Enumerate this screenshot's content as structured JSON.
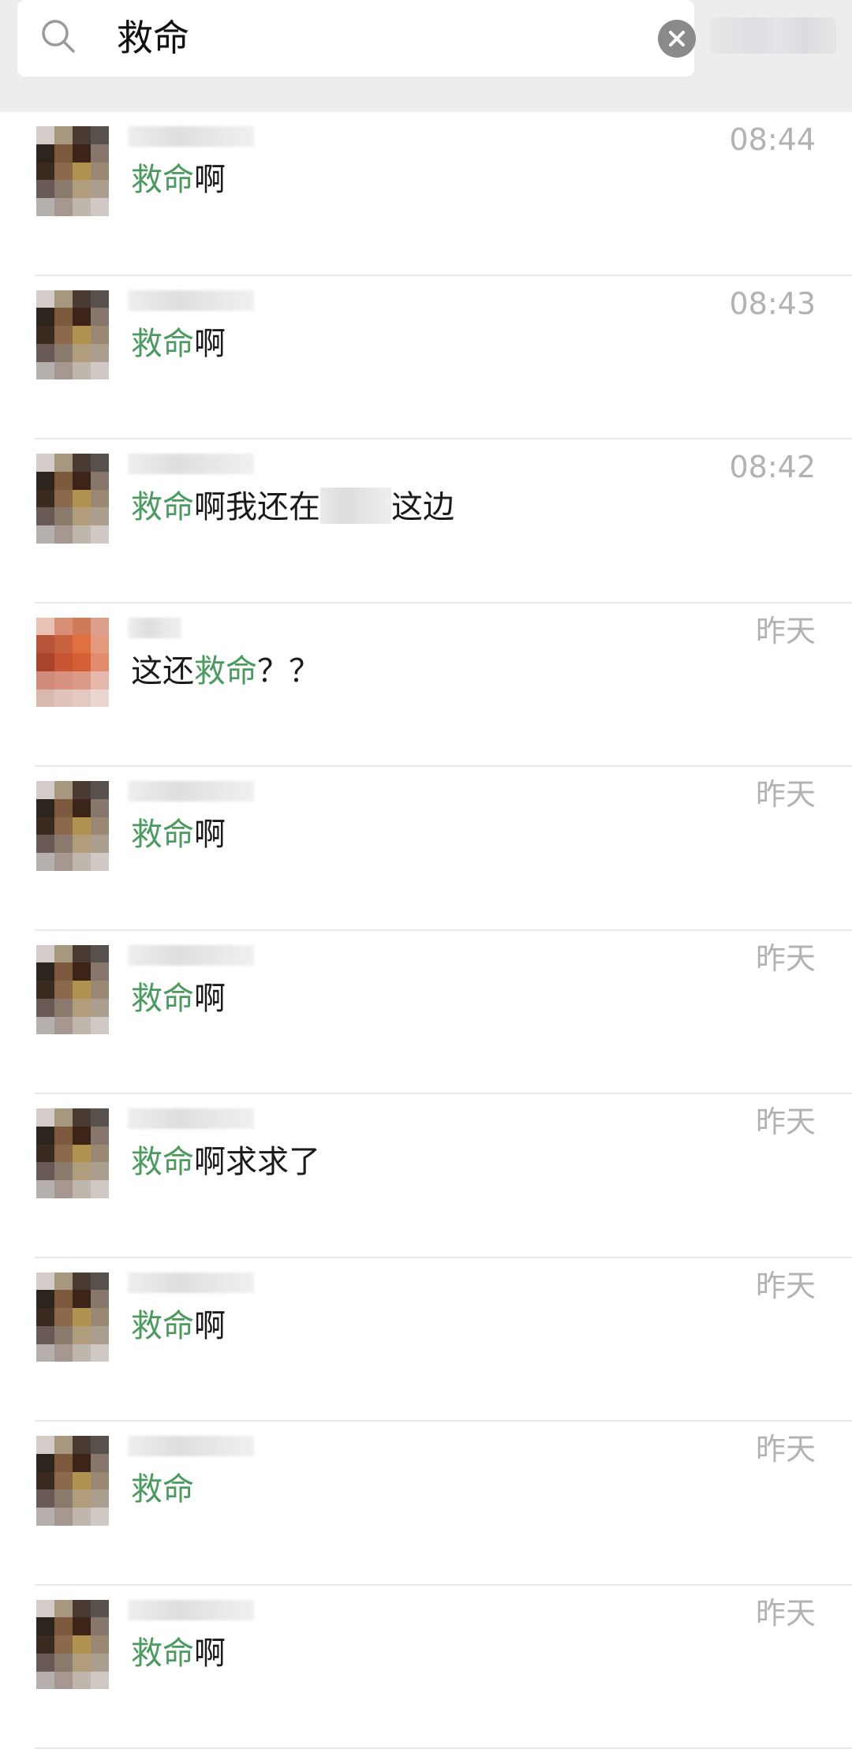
{
  "search": {
    "query": "救命"
  },
  "results": [
    {
      "time": "08:44",
      "name_short": false,
      "avatar": "dark",
      "pre": "",
      "hl": "救命",
      "post": "啊"
    },
    {
      "time": "08:43",
      "name_short": false,
      "avatar": "dark",
      "pre": "",
      "hl": "救命",
      "post": "啊"
    },
    {
      "time": "08:42",
      "name_short": false,
      "avatar": "dark",
      "pre": "",
      "hl": "救命",
      "post": "啊我还在",
      "redacted": true,
      "tail": "这边"
    },
    {
      "time": "昨天",
      "name_short": true,
      "avatar": "orange",
      "pre": "这还",
      "hl": "救命",
      "post": "？？"
    },
    {
      "time": "昨天",
      "name_short": false,
      "avatar": "dark",
      "pre": "",
      "hl": "救命",
      "post": "啊"
    },
    {
      "time": "昨天",
      "name_short": false,
      "avatar": "dark",
      "pre": "",
      "hl": "救命",
      "post": "啊"
    },
    {
      "time": "昨天",
      "name_short": false,
      "avatar": "dark",
      "pre": "",
      "hl": "救命",
      "post": "啊求求了"
    },
    {
      "time": "昨天",
      "name_short": false,
      "avatar": "dark",
      "pre": "",
      "hl": "救命",
      "post": "啊"
    },
    {
      "time": "昨天",
      "name_short": false,
      "avatar": "dark",
      "pre": "",
      "hl": "救命",
      "post": ""
    },
    {
      "time": "昨天",
      "name_short": false,
      "avatar": "dark",
      "pre": "",
      "hl": "救命",
      "post": "啊"
    }
  ],
  "colors": {
    "highlight": "#4c9a5f",
    "time": "#b2b2b2",
    "header_bg": "#ededed"
  },
  "avatar_palettes": {
    "dark": [
      "#d4ccc8",
      "#a8977f",
      "#4a3a32",
      "#58524f",
      "#2e241e",
      "#7d5a3e",
      "#3c2518",
      "#86766c",
      "#3b2a20",
      "#8b6a4c",
      "#b2924f",
      "#9a8873",
      "#6a5a55",
      "#8a7a6c",
      "#b19c7c",
      "#ab9e8f",
      "#b5b0ad",
      "#a69890",
      "#c0b7ac",
      "#cec9c4"
    ],
    "orange": [
      "#e9c2b4",
      "#d88f73",
      "#cf7959",
      "#dc9f8c",
      "#b55438",
      "#c8623e",
      "#e0703f",
      "#e49a7c",
      "#a9452b",
      "#c95534",
      "#d45f35",
      "#e18c6c",
      "#cf8c7a",
      "#d7917e",
      "#db9a85",
      "#e4b8aa",
      "#d9b8ae",
      "#e0c3ba",
      "#e3c9c0",
      "#ebd7cf"
    ]
  }
}
